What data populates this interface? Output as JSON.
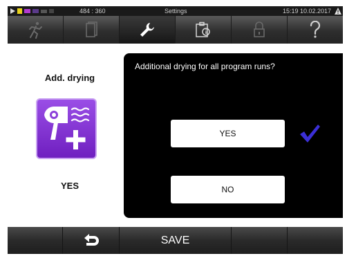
{
  "status_bar": {
    "coords": "484 : 360",
    "title": "Settings",
    "datetime": "15:19  10.02.2017"
  },
  "nav": {
    "items": [
      {
        "icon": "running-person-icon",
        "active": false
      },
      {
        "icon": "document-icon",
        "active": false
      },
      {
        "icon": "wrench-icon",
        "active": true
      },
      {
        "icon": "clipboard-info-icon",
        "active": false
      },
      {
        "icon": "padlock-icon",
        "active": false
      },
      {
        "icon": "help-icon",
        "active": false
      }
    ]
  },
  "program": {
    "title": "Add. drying",
    "icon": "hair-dryer-plus-icon",
    "current_value": "YES"
  },
  "dialog": {
    "question": "Additional drying for all program runs?",
    "options": [
      {
        "label": "YES",
        "selected": true
      },
      {
        "label": "NO",
        "selected": false
      }
    ]
  },
  "bottom_bar": {
    "back_icon": "back-arrow-icon",
    "save_label": "SAVE"
  },
  "colors": {
    "accent_purple": "#7a2fd0",
    "check_blue": "#3b2fd6",
    "dialog_bg": "#000000"
  }
}
